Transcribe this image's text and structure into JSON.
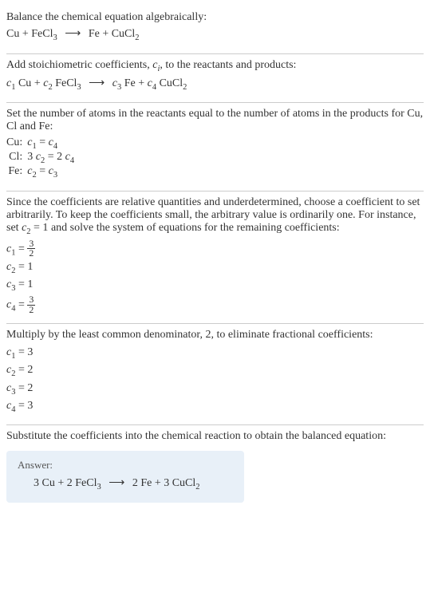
{
  "step1": {
    "instr": "Balance the chemical equation algebraically:",
    "lhs1": "Cu",
    "plus1": "+",
    "lhs2": "FeCl",
    "lhs2sub": "3",
    "arrow": "⟶",
    "rhs1": "Fe",
    "plus2": "+",
    "rhs2": "CuCl",
    "rhs2sub": "2"
  },
  "step2": {
    "instr_a": "Add stoichiometric coefficients, ",
    "instr_ci": "c",
    "instr_cisub": "i",
    "instr_b": ", to the reactants and products:",
    "c1": "c",
    "c1s": "1",
    "sp1": " Cu",
    "plus1": "+",
    "c2": "c",
    "c2s": "2",
    "sp2": " FeCl",
    "sp2sub": "3",
    "arrow": "⟶",
    "c3": "c",
    "c3s": "3",
    "sp3": " Fe",
    "plus2": "+",
    "c4": "c",
    "c4s": "4",
    "sp4": " CuCl",
    "sp4sub": "2"
  },
  "step3": {
    "instr": "Set the number of atoms in the reactants equal to the number of atoms in the products for Cu, Cl and Fe:",
    "rows": [
      {
        "el": "Cu:",
        "lhs_c": "c",
        "lhs_s": "1",
        "eq": " = ",
        "rhs_c": "c",
        "rhs_s": "4",
        "pre": "",
        "rpre": ""
      },
      {
        "el": "Cl:",
        "lhs_c": "c",
        "lhs_s": "2",
        "eq": " = ",
        "rhs_c": "c",
        "rhs_s": "4",
        "pre": "3 ",
        "rpre": "2 "
      },
      {
        "el": "Fe:",
        "lhs_c": "c",
        "lhs_s": "2",
        "eq": " = ",
        "rhs_c": "c",
        "rhs_s": "3",
        "pre": "",
        "rpre": ""
      }
    ]
  },
  "step4": {
    "instr_a": "Since the coefficients are relative quantities and underdetermined, choose a coefficient to set arbitrarily. To keep the coefficients small, the arbitrary value is ordinarily one. For instance, set ",
    "instr_c": "c",
    "instr_cs": "2",
    "instr_eq": " = 1",
    "instr_b": " and solve the system of equations for the remaining coefficients:",
    "lines": [
      {
        "c": "c",
        "s": "1",
        "eq": " = ",
        "num": "3",
        "den": "2",
        "plain": ""
      },
      {
        "c": "c",
        "s": "2",
        "eq": " = ",
        "num": "",
        "den": "",
        "plain": "1"
      },
      {
        "c": "c",
        "s": "3",
        "eq": " = ",
        "num": "",
        "den": "",
        "plain": "1"
      },
      {
        "c": "c",
        "s": "4",
        "eq": " = ",
        "num": "3",
        "den": "2",
        "plain": ""
      }
    ]
  },
  "step5": {
    "instr": "Multiply by the least common denominator, 2, to eliminate fractional coefficients:",
    "lines": [
      {
        "c": "c",
        "s": "1",
        "eq": " = ",
        "v": "3"
      },
      {
        "c": "c",
        "s": "2",
        "eq": " = ",
        "v": "2"
      },
      {
        "c": "c",
        "s": "3",
        "eq": " = ",
        "v": "2"
      },
      {
        "c": "c",
        "s": "4",
        "eq": " = ",
        "v": "3"
      }
    ]
  },
  "step6": {
    "instr": "Substitute the coefficients into the chemical reaction to obtain the balanced equation:",
    "answer_label": "Answer:",
    "n1": "3 ",
    "sp1": "Cu",
    "plus1": " + ",
    "n2": "2 ",
    "sp2": "FeCl",
    "sp2sub": "3",
    "arrow": "⟶",
    "n3": "2 ",
    "sp3": "Fe",
    "plus2": " + ",
    "n4": "3 ",
    "sp4": "CuCl",
    "sp4sub": "2"
  }
}
